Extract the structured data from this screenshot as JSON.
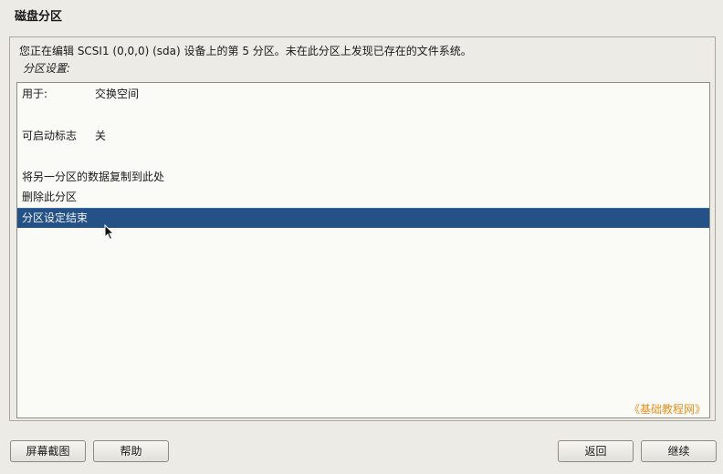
{
  "header": {
    "title": "磁盘分区"
  },
  "main": {
    "info_text": "您正在编辑 SCSI1 (0,0,0) (sda) 设备上的第 5 分区。未在此分区上发现已存在的文件系统。",
    "section_label": "分区设置:",
    "items": [
      {
        "label": "用于:",
        "value": "交换空间"
      },
      {
        "label": "可启动标志",
        "value": "关"
      },
      {
        "label": "将另一分区的数据复制到此处",
        "value": ""
      },
      {
        "label": "删除此分区",
        "value": ""
      },
      {
        "label": "分区设定结束",
        "value": "",
        "selected": true
      }
    ],
    "watermark": "《基础教程网》"
  },
  "buttons": {
    "screenshot": "屏幕截图",
    "help": "帮助",
    "back": "返回",
    "continue": "继续"
  },
  "colors": {
    "selection": "#245186",
    "background": "#ecebe6",
    "watermark": "#e8901e"
  }
}
